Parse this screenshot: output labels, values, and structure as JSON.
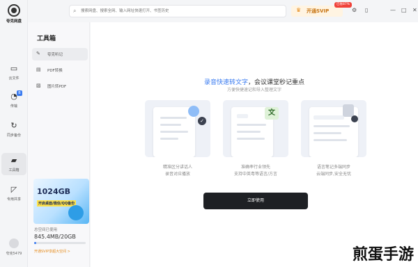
{
  "app": {
    "logo_text": "夸克网盘"
  },
  "rail": [
    {
      "name": "rail-item-files",
      "icon": "folder-icon",
      "glyph": "▭",
      "label": "云文件"
    },
    {
      "name": "rail-item-transfer",
      "icon": "transfer-icon",
      "glyph": "◔",
      "label": "传输",
      "badge": "B"
    },
    {
      "name": "rail-item-backup",
      "icon": "sync-icon",
      "glyph": "↻",
      "label": "同步备份"
    },
    {
      "name": "rail-item-toolbox",
      "icon": "toolbox-icon",
      "glyph": "▰",
      "label": "工具箱",
      "active": true
    },
    {
      "name": "rail-item-shared",
      "icon": "share-icon",
      "glyph": "◸",
      "label": "专用共享"
    }
  ],
  "user": {
    "name": "夸克5479"
  },
  "topbar": {
    "search_placeholder": "搜索网盘、搜索全网、输入网址快速打开、书签历史",
    "svip_label": "开通SVIP",
    "svip_tag": "已省87%",
    "icons": [
      "settings-icon",
      "phone-icon",
      "minimize-icon",
      "maximize-icon",
      "close-icon"
    ],
    "glyphs": [
      "⚙",
      "▯",
      "—",
      "□",
      "✕"
    ]
  },
  "panel": {
    "title": "工具箱",
    "tools": [
      {
        "name": "tool-item-notes",
        "icon": "note-icon",
        "glyph": "✎",
        "label": "夸克听记",
        "active": true
      },
      {
        "name": "tool-item-pdf-convert",
        "icon": "pdf-icon",
        "glyph": "▤",
        "label": "PDF转换"
      },
      {
        "name": "tool-item-image-to-pdf",
        "icon": "image-icon",
        "glyph": "▨",
        "label": "图片转PDF"
      }
    ],
    "promo": {
      "big": "1024GB",
      "sub": "开启桌面/微信/QQ备份"
    },
    "storage": {
      "label": "总空间已使用",
      "value": "845.4MB/20GB",
      "used_fraction": 0.04,
      "upgrade": "开通SVIP享超大空间 >"
    }
  },
  "main": {
    "headline_highlight": "录音快速转文字",
    "headline_rest": "，会议课堂秒记重点",
    "sub_headline": "方便快捷速记和导入整理文字",
    "features": [
      {
        "line1": "精准区分讲话人",
        "line2": "录音对应播放"
      },
      {
        "line1": "准确率行业领先",
        "line2": "支持中英粤等语言/方言"
      },
      {
        "line1": "语言笔记多端同步",
        "line2": "云端同步,安全无忧"
      }
    ],
    "cta_label": "立即使用"
  },
  "watermark": "煎蛋手游",
  "colors": {
    "accent": "#3a7bf0",
    "svip": "#e58b1c",
    "cta": "#1e2024"
  }
}
